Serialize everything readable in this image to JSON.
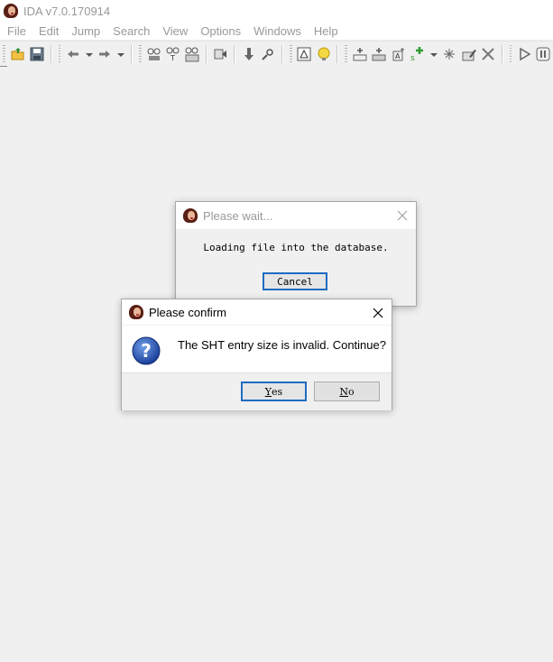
{
  "window": {
    "title": "IDA v7.0.170914"
  },
  "menu": [
    "File",
    "Edit",
    "Jump",
    "Search",
    "View",
    "Options",
    "Windows",
    "Help"
  ],
  "toolbar": {
    "icons": [
      "open-file-icon",
      "save-icon",
      "back-arrow-icon",
      "dropdown-icon",
      "forward-arrow-icon",
      "dropdown-icon",
      "search-binary-icon",
      "search-text-icon",
      "search-immediate-icon",
      "jump-icon",
      "down-arrow-icon",
      "find-icon",
      "graph-icon",
      "bulb-icon",
      "code-icon",
      "data-icon",
      "string-icon",
      "add-segment-icon",
      "dropdown-icon",
      "struct-icon",
      "edit-icon",
      "delete-icon",
      "play-icon",
      "pause-icon"
    ]
  },
  "wait_dialog": {
    "title": "Please wait...",
    "message": "Loading file into the database.",
    "cancel_label": "Cancel"
  },
  "confirm_dialog": {
    "title": "Please confirm",
    "message": "The SHT entry size is invalid. Continue?",
    "yes_first": "Y",
    "yes_rest": "es",
    "no_first": "N",
    "no_rest": "o"
  },
  "colors": {
    "accent": "#1f6cc1",
    "background": "#f0f0f0",
    "menu_text": "#999999"
  }
}
